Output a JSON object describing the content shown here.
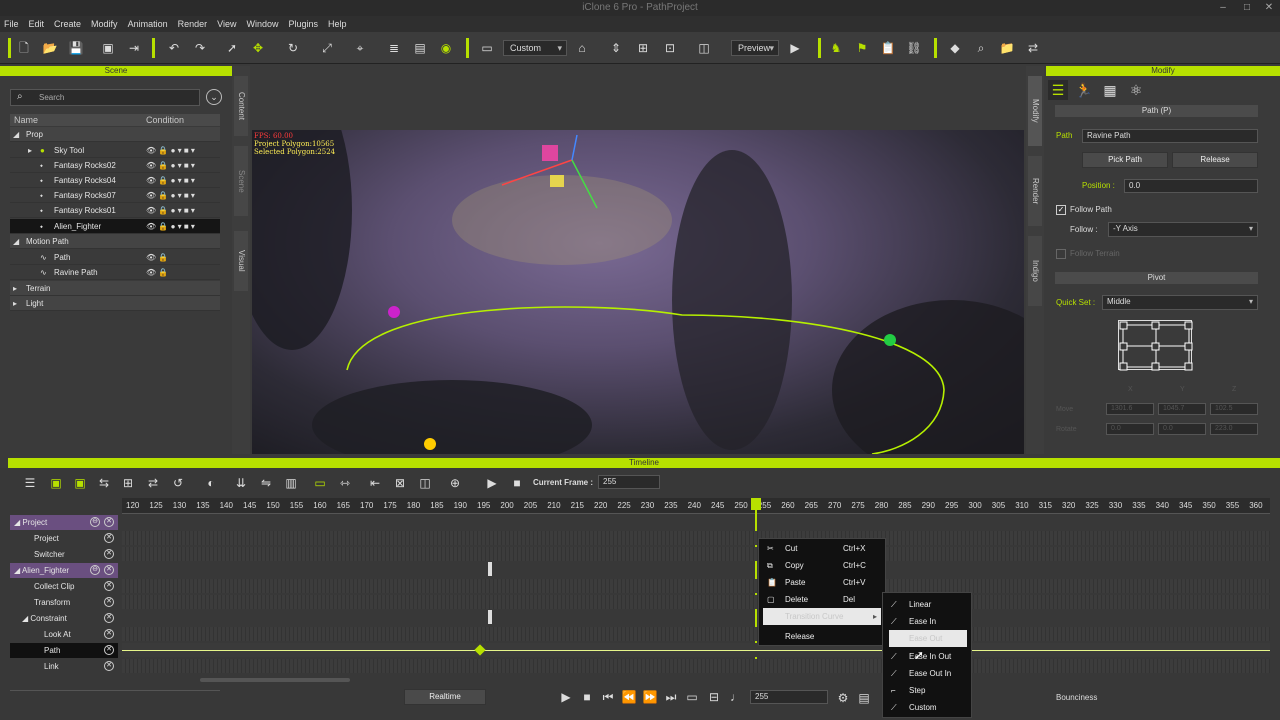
{
  "window": {
    "title": "iClone 6 Pro - PathProject"
  },
  "menu": [
    "File",
    "Edit",
    "Create",
    "Modify",
    "Animation",
    "Render",
    "View",
    "Window",
    "Plugins",
    "Help"
  ],
  "toolbar": {
    "camera_combo": "Custom",
    "preview_combo": "Preview"
  },
  "scene": {
    "header": "Scene",
    "search_placeholder": "Search",
    "columns": {
      "name": "Name",
      "condition": "Condition"
    },
    "items": [
      {
        "label": "Prop"
      },
      {
        "label": "Sky Tool"
      },
      {
        "label": "Fantasy Rocks02"
      },
      {
        "label": "Fantasy Rocks04"
      },
      {
        "label": "Fantasy Rocks07"
      },
      {
        "label": "Fantasy Rocks01"
      },
      {
        "label": "Alien_Fighter"
      },
      {
        "label": "Motion Path"
      },
      {
        "label": "Path"
      },
      {
        "label": "Ravine Path"
      },
      {
        "label": "Terrain"
      },
      {
        "label": "Light"
      }
    ]
  },
  "side_tabs": {
    "left": [
      "Content",
      "Scene",
      "Visual"
    ],
    "right": [
      "Modify",
      "Render",
      "Indigo"
    ]
  },
  "viewport": {
    "fps": "FPS: 60.00",
    "polys": "Project Polygon:10565",
    "sel_polys": "Selected Polygon:2524"
  },
  "modify": {
    "header": "Modify",
    "section_path": "Path (P)",
    "path_label": "Path",
    "path_value": "Ravine Path",
    "pick_path": "Pick Path",
    "release": "Release",
    "position_label": "Position :",
    "position_value": "0.0",
    "follow_path": "Follow Path",
    "follow_label": "Follow :",
    "follow_value": "-Y Axis",
    "follow_terrain": "Follow Terrain",
    "section_pivot": "Pivot",
    "quickset_label": "Quick Set :",
    "quickset_value": "Middle",
    "pivot_axes": [
      "X",
      "Y",
      "Z"
    ],
    "move_label": "Move",
    "move_values": [
      "1301.6",
      "1045.7",
      "102.5"
    ],
    "rotate_label": "Rotate",
    "rotate_values": [
      "0.0",
      "0.0",
      "223.0"
    ],
    "bounciness": "Bounciness"
  },
  "timeline": {
    "header": "Timeline",
    "current_frame_label": "Current Frame :",
    "current_frame": "255",
    "ruler": [
      "120",
      "125",
      "130",
      "135",
      "140",
      "145",
      "150",
      "155",
      "160",
      "165",
      "170",
      "175",
      "180",
      "185",
      "190",
      "195",
      "200",
      "205",
      "210",
      "215",
      "220",
      "225",
      "230",
      "235",
      "240",
      "245",
      "250",
      "255",
      "260",
      "265",
      "270",
      "275",
      "280",
      "285",
      "290",
      "295",
      "300",
      "305",
      "310",
      "315",
      "320",
      "325",
      "330",
      "335",
      "340",
      "345",
      "350",
      "355",
      "360"
    ],
    "tracks": [
      "Project",
      "Project",
      "Switcher",
      "Alien_Fighter",
      "Collect Clip",
      "Transform",
      "Constraint",
      "Look At",
      "Path",
      "Link"
    ],
    "realtime": "Realtime",
    "frame_box": "255"
  },
  "context_menu": [
    {
      "label": "Cut",
      "shortcut": "Ctrl+X"
    },
    {
      "label": "Copy",
      "shortcut": "Ctrl+C"
    },
    {
      "label": "Paste",
      "shortcut": "Ctrl+V"
    },
    {
      "label": "Delete",
      "shortcut": "Del"
    },
    {
      "label": "Transition Curve",
      "shortcut": ""
    },
    {
      "label": "Release",
      "shortcut": ""
    }
  ],
  "submenu": [
    "Linear",
    "Ease In",
    "Ease Out",
    "Ease In Out",
    "Ease Out In",
    "Step",
    "Custom"
  ]
}
